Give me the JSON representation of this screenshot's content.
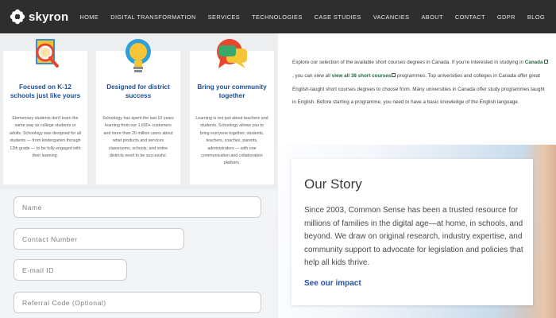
{
  "brand": {
    "name": "skyron"
  },
  "nav": [
    "HOME",
    "DIGITAL TRANSFORMATION",
    "SERVICES",
    "TECHNOLOGIES",
    "CASE STUDIES",
    "VACANCIES",
    "ABOUT",
    "CONTACT",
    "GDPR",
    "BLOG"
  ],
  "features": [
    {
      "icon": "magnifier-book-icon",
      "title": "Focused on K-12 schools just like yours",
      "body": "Elementary students don't learn the same way as college students or adults. Schoology was designed for all students — from kindergarten through 12th grade — to be fully engaged with their learning."
    },
    {
      "icon": "lightbulb-icon",
      "title": "Designed for district success",
      "body": "Schoology has spent the last 10 years learning from our 1,600+ customers and more than 20 million users about what products and services classrooms, schools, and entire districts need to be successful."
    },
    {
      "icon": "chat-bubbles-icon",
      "title": "Bring your community together",
      "body": "Learning is not just about teachers and students. Schoology allows you to bring everyone together: students, teachers, coaches, parents, administrators — with one communication and collaboration platform."
    }
  ],
  "form": {
    "name_placeholder": "Name",
    "contact_placeholder": "Contact Number",
    "email_placeholder": "E-mail ID",
    "referral_placeholder": "Referral Code (Optional)"
  },
  "intro": {
    "part1": "Explore our selection of the available short courses degrees in Canada. If you're interested in studying in ",
    "link_country": "Canada",
    "part2": ", you can view all ",
    "link_courses": "view all 38 short courses",
    "part3": " programmes. Top universities and colleges in Canada offer great English-taught short courses degrees to choose from. Many universities in Canada offer study programmes taught in English. Before starting a programme, you need to have a basic knowledge of the English language."
  },
  "story": {
    "title": "Our Story",
    "body": "Since 2003, Common Sense has been a trusted resource for millions of families in the digital age—at home, in schools, and beyond. We draw on original research, industry expertise, and community support to advocate for legislation and policies that help all kids thrive.",
    "link": "See our impact"
  },
  "colors": {
    "header_bg": "#2e2e2e",
    "card_title": "#1c4e96",
    "link_green": "#1f6b3b",
    "impact_link": "#2c4fa5"
  }
}
